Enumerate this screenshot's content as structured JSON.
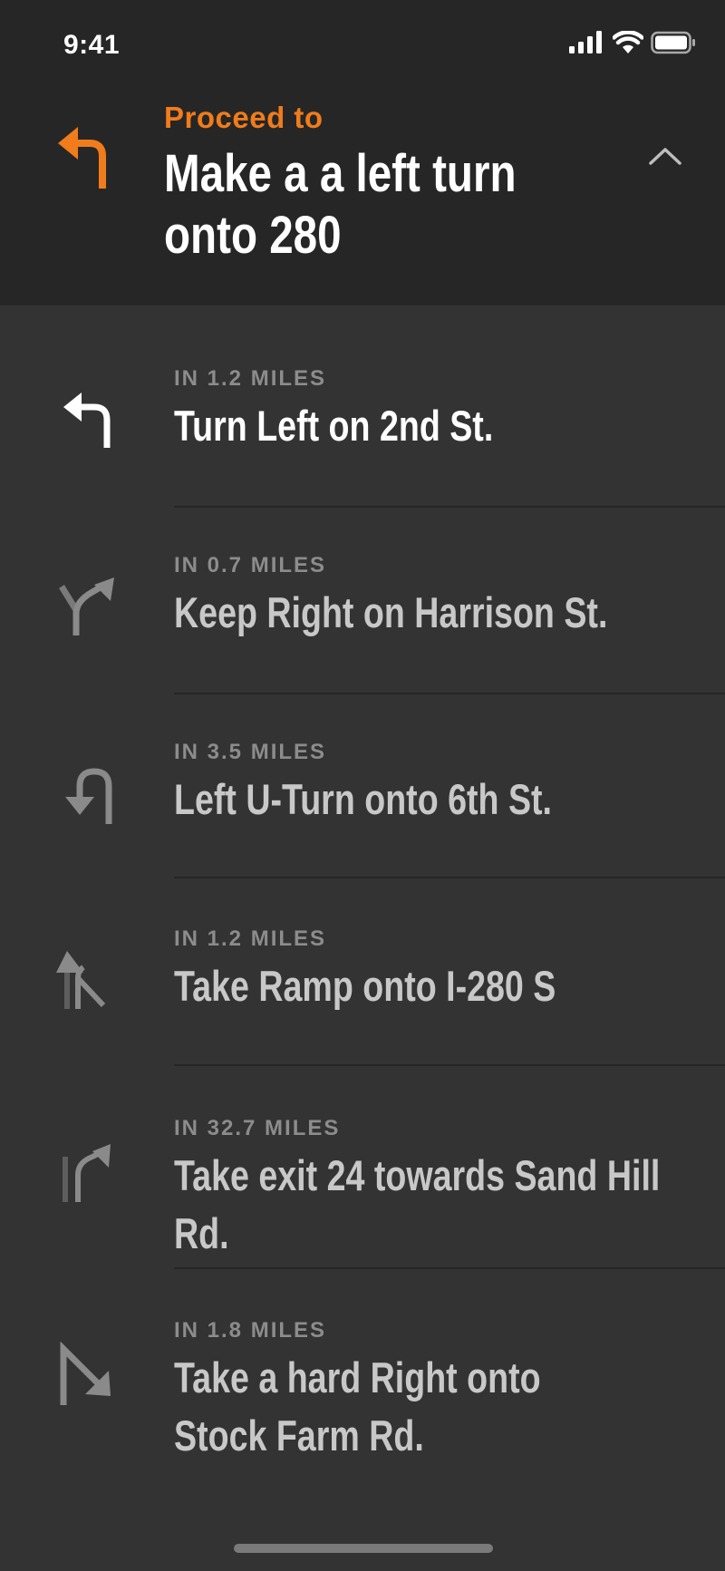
{
  "status_bar": {
    "time": "9:41"
  },
  "header": {
    "label": "Proceed to",
    "title": "Make a a left turn onto 280",
    "maneuver_icon": "turn-left-icon",
    "collapse_icon": "chevron-up-icon",
    "accent_color": "#f07c1b"
  },
  "steps": [
    {
      "distance": "IN 1.2 MILES",
      "instruction": "Turn Left on 2nd St.",
      "icon": "turn-left-icon",
      "active": true
    },
    {
      "distance": "IN 0.7 MILES",
      "instruction": "Keep Right on Harrison St.",
      "icon": "keep-right-icon"
    },
    {
      "distance": "IN 3.5 MILES",
      "instruction": "Left U-Turn onto 6th St.",
      "icon": "u-turn-left-icon"
    },
    {
      "distance": "IN 1.2 MILES",
      "instruction": "Take Ramp onto I-280 S",
      "icon": "ramp-left-icon"
    },
    {
      "distance": "IN 32.7 MILES",
      "instruction": "Take exit 24 towards Sand Hill Rd.",
      "icon": "exit-right-icon"
    },
    {
      "distance": "IN 1.8 MILES",
      "instruction": "Take a hard Right onto Stock Farm Rd.",
      "icon": "sharp-right-icon"
    }
  ]
}
